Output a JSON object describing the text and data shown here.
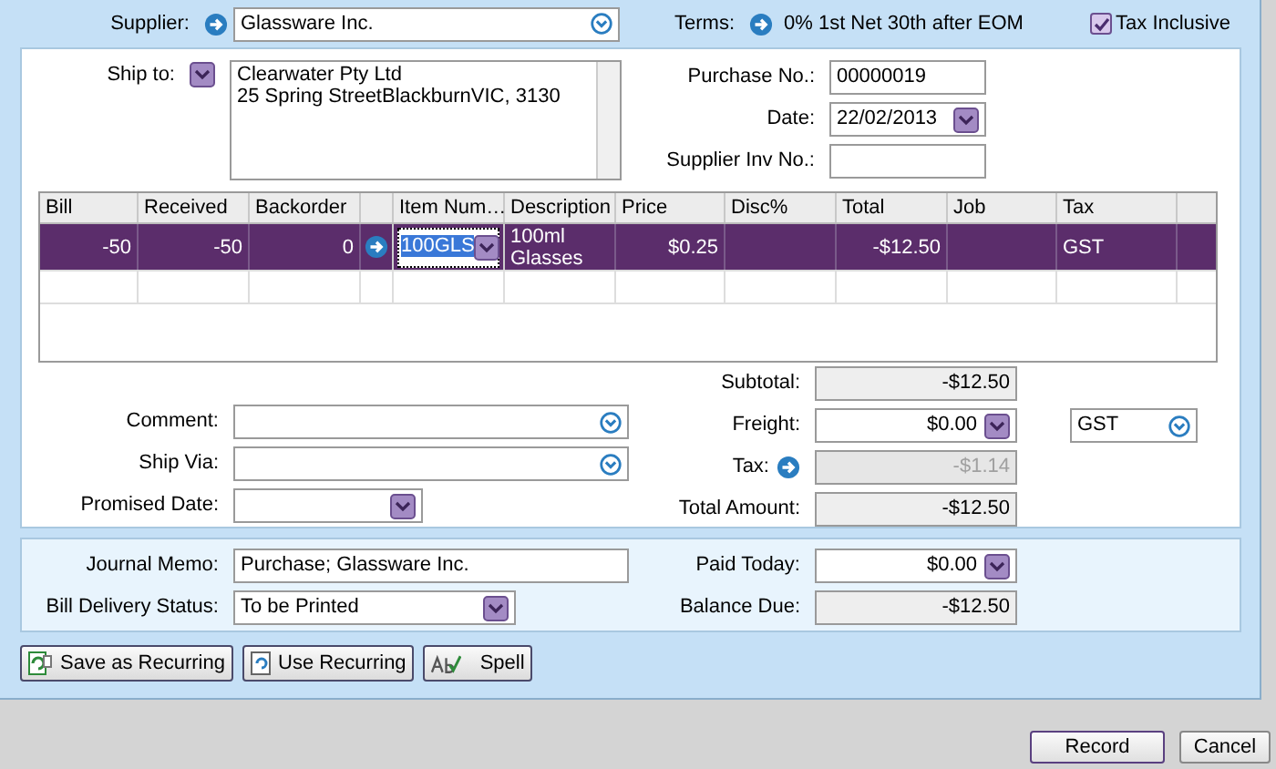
{
  "supplier": {
    "label": "Supplier:",
    "value": "Glassware Inc."
  },
  "terms": {
    "label": "Terms:",
    "value": "0% 1st Net 30th after EOM"
  },
  "tax_inclusive": {
    "label": "Tax Inclusive",
    "checked": true
  },
  "ship_to": {
    "label": "Ship to:",
    "lines": [
      "Clearwater Pty Ltd",
      "25 Spring StreetBlackburnVIC, 3130"
    ]
  },
  "header_fields": [
    {
      "label": "Purchase No.:",
      "value": "00000019",
      "kind": "text"
    },
    {
      "label": "Date:",
      "value": "22/02/2013",
      "kind": "date"
    },
    {
      "label": "Supplier Inv No.:",
      "kind": "text"
    }
  ],
  "table": {
    "columns": [
      {
        "label": "Bill",
        "kind": "text"
      },
      {
        "label": "Received",
        "kind": "text"
      },
      {
        "label": "Backorder",
        "kind": "text"
      },
      {
        "kind": "arrow"
      },
      {
        "label": "Item Num…",
        "kind": "text"
      },
      {
        "label": "Description",
        "kind": "text"
      },
      {
        "label": "Price",
        "kind": "text"
      },
      {
        "label": "Disc%",
        "kind": "text"
      },
      {
        "label": "Total",
        "kind": "text"
      },
      {
        "label": "Job",
        "kind": "text"
      },
      {
        "label": "Tax",
        "kind": "text"
      }
    ],
    "rows": [
      {
        "selected": true,
        "bill": "-50",
        "received": "-50",
        "backorder": "0",
        "item_number": "100GLS",
        "description": "100ml Glasses",
        "price": "$0.25",
        "total": "-$12.50",
        "tax": "GST"
      }
    ]
  },
  "left_fields": [
    {
      "label": "Comment:",
      "kind": "combo"
    },
    {
      "label": "Ship Via:",
      "kind": "combo"
    },
    {
      "label": "Promised Date:",
      "kind": "date"
    }
  ],
  "totals": [
    {
      "label": "Subtotal:",
      "value": "-$12.50",
      "kind": "readonly"
    },
    {
      "label": "Freight:",
      "value": "$0.00",
      "kind": "editable",
      "tax_code": "GST"
    },
    {
      "label": "Tax:",
      "value": "-$1.14",
      "kind": "disabled"
    },
    {
      "label": "Total Amount:",
      "value": "-$12.50",
      "kind": "readonly"
    }
  ],
  "journal_memo": {
    "label": "Journal Memo:",
    "value": "Purchase; Glassware Inc."
  },
  "bill_delivery_status": {
    "label": "Bill Delivery Status:",
    "value": "To be Printed"
  },
  "payment": [
    {
      "label": "Paid Today:",
      "value": "$0.00",
      "kind": "editable"
    },
    {
      "label": "Balance Due:",
      "value": "-$12.50",
      "kind": "readonly"
    }
  ],
  "action_buttons": [
    {
      "label": "Save as Recurring",
      "kind": "save"
    },
    {
      "label": "Use Recurring",
      "kind": "use"
    },
    {
      "label": "Spell",
      "kind": "spell"
    }
  ],
  "footer_buttons": [
    "Record",
    "Cancel"
  ]
}
